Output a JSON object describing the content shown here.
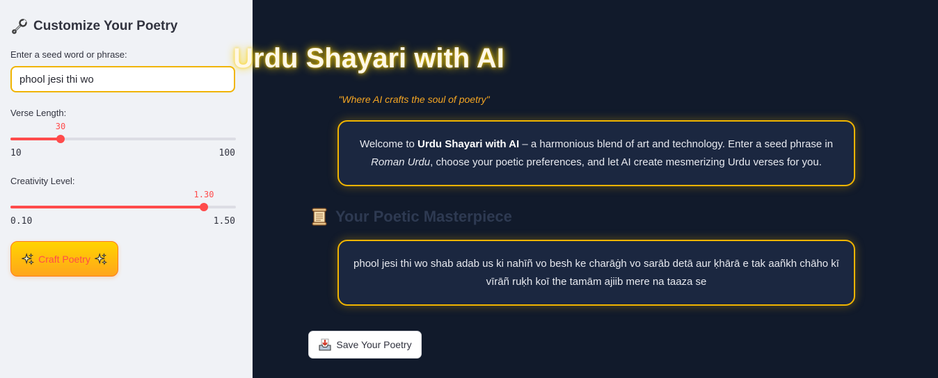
{
  "sidebar": {
    "title": "Customize Your Poetry",
    "seed": {
      "label": "Enter a seed word or phrase:",
      "value": "phool jesi thi wo"
    },
    "verse_length": {
      "label": "Verse Length:",
      "value": "30",
      "min": "10",
      "max": "100",
      "fraction": 0.222
    },
    "creativity": {
      "label": "Creativity Level:",
      "value": "1.30",
      "min": "0.10",
      "max": "1.50",
      "fraction": 0.857
    },
    "craft_button": "Craft Poetry"
  },
  "main": {
    "title": "Urdu Shayari with AI",
    "tagline": "\"Where AI crafts the soul of poetry\"",
    "welcome": {
      "p1": "Welcome to ",
      "bold": "Urdu Shayari with AI",
      "p2": " – a harmonious blend of art and technology. Enter a seed phrase in ",
      "italic": "Roman Urdu",
      "p3": ", choose your poetic preferences, and let AI create mesmerizing Urdu verses for you."
    },
    "section_title": "Your Poetic Masterpiece",
    "poetry_text": "phool jesi thi wo shab adab us ki nahīñ vo besh ke charāġh vo sarāb detā aur ḳhārā e tak aañkh chāho kī vīrāñ ruḳh koī the tamām ajiib mere na taaza se",
    "save_button": "Save Your Poetry"
  },
  "colors": {
    "accent_red": "#ff4b4b",
    "gold": "#f0b400",
    "background_dark": "#111a2b"
  }
}
